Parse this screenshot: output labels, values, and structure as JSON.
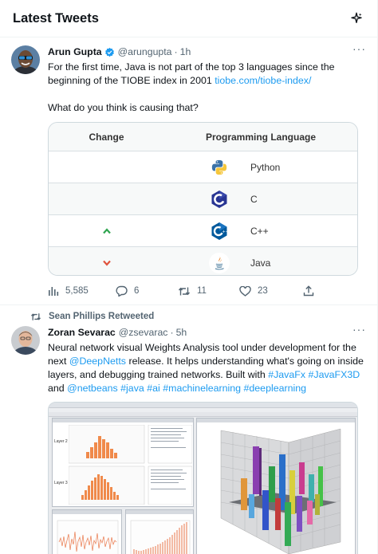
{
  "header": {
    "title": "Latest Tweets",
    "icon": "sparkle-icon"
  },
  "tweet1": {
    "name": "Arun Gupta",
    "handle": "@arungupta",
    "dot": "·",
    "time": "1h",
    "more": "···",
    "text_line1": "For the first time, Java is not part of the top 3 languages since the beginning of the TIOBE index in 2001 ",
    "link": "tiobe.com/tiobe-index/",
    "text_line2": "What do you think is causing that?",
    "table": {
      "headers": [
        "Change",
        "Programming Language"
      ],
      "rows": [
        {
          "change": "none",
          "language": "Python",
          "icon": "python-icon"
        },
        {
          "change": "none",
          "language": "C",
          "icon": "c-icon"
        },
        {
          "change": "up",
          "language": "C++",
          "icon": "cpp-icon"
        },
        {
          "change": "down",
          "language": "Java",
          "icon": "java-icon"
        }
      ]
    },
    "stats": {
      "views": "5,585",
      "replies": "6",
      "retweets": "11",
      "likes": "23"
    }
  },
  "retweet_context": {
    "text": "Sean Phillips Retweeted"
  },
  "tweet2": {
    "name": "Zoran Sevarac",
    "handle": "@zsevarac",
    "dot": "·",
    "time": "5h",
    "more": "···",
    "text_a": "Neural network visual Weights Analysis tool under development for the next ",
    "mention1": "@DeepNetts",
    "text_b": " release. It helps  understanding what's going on inside layers, and debugging trained networks. Built with ",
    "tag1": "#JavaFx",
    "tag2": "#JavaFX3D",
    "text_c": " and ",
    "mention2": "@netbeans",
    "tag3": "#java",
    "tag4": "#ai",
    "tag5": "#machinelearning",
    "tag6": "#deeplearning",
    "media_labels": {
      "layer2": "Layer 2",
      "layer3": "Layer 3"
    }
  },
  "colors": {
    "link": "#1d9bf0",
    "secondary": "#536471",
    "up": "#2ea44f",
    "down": "#e0533d"
  }
}
